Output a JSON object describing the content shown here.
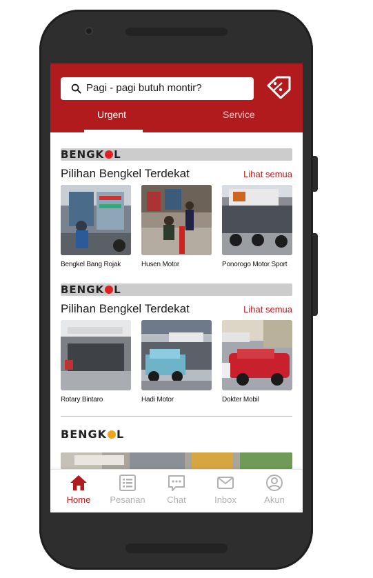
{
  "search": {
    "placeholder": "Pagi - pagi butuh montir?"
  },
  "tabs": {
    "urgent": "Urgent",
    "service": "Service"
  },
  "brand": {
    "prefix": "BENGK",
    "suffix": "L"
  },
  "sections": [
    {
      "title": "Pilihan Bengkel Terdekat",
      "see_all": "Lihat semua",
      "items": [
        {
          "name": "Bengkel Bang Rojak"
        },
        {
          "name": "Husen Motor"
        },
        {
          "name": "Ponorogo Motor Sport"
        }
      ]
    },
    {
      "title": "Pilihan Bengkel Terdekat",
      "see_all": "Lihat semua",
      "items": [
        {
          "name": "Rotary Bintaro"
        },
        {
          "name": "Hadi Motor"
        },
        {
          "name": "Dokter Mobil"
        }
      ]
    }
  ],
  "nav": {
    "home": "Home",
    "orders": "Pesanan",
    "chat": "Chat",
    "inbox": "Inbox",
    "account": "Akun"
  },
  "colors": {
    "primary": "#b21b1d",
    "inactive": "#b0b0b0"
  }
}
